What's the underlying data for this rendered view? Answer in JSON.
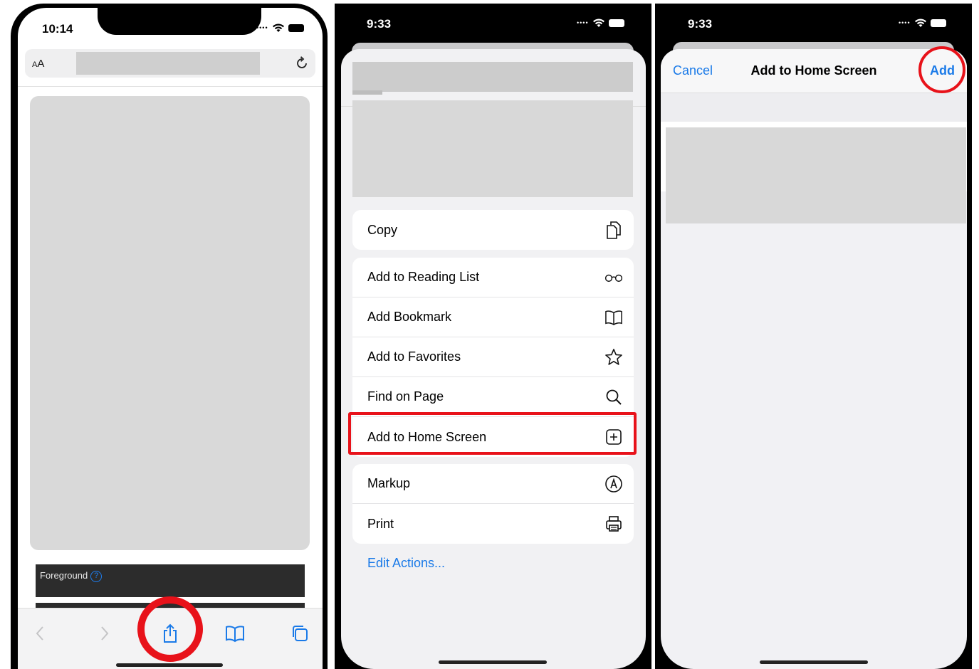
{
  "panel1": {
    "status": {
      "time": "10:14"
    },
    "urlbar": {
      "text_size_label": "A",
      "text_size_label_large": "A"
    },
    "foreground": {
      "label": "Foreground",
      "help_glyph": "?"
    },
    "toolbar": {
      "back_icon": "chevron-left-icon",
      "forward_icon": "chevron-right-icon",
      "share_icon": "share-icon",
      "bookmarks_icon": "book-icon",
      "tabs_icon": "tabs-icon"
    }
  },
  "panel2": {
    "status": {
      "time": "9:33"
    },
    "groups": [
      [
        {
          "label": "Copy",
          "icon": "copy-icon"
        }
      ],
      [
        {
          "label": "Add to Reading List",
          "icon": "glasses-icon"
        },
        {
          "label": "Add Bookmark",
          "icon": "book-icon"
        },
        {
          "label": "Add to Favorites",
          "icon": "star-icon"
        },
        {
          "label": "Find on Page",
          "icon": "search-icon"
        },
        {
          "label": "Add to Home Screen",
          "icon": "plus-square-icon"
        }
      ],
      [
        {
          "label": "Markup",
          "icon": "markup-icon"
        },
        {
          "label": "Print",
          "icon": "printer-icon"
        }
      ]
    ],
    "edit_actions": "Edit Actions..."
  },
  "panel3": {
    "status": {
      "time": "9:33"
    },
    "nav": {
      "cancel": "Cancel",
      "title": "Add to Home Screen",
      "add": "Add"
    }
  },
  "colors": {
    "accent": "#1a7ae8",
    "highlight": "#e8121a"
  }
}
